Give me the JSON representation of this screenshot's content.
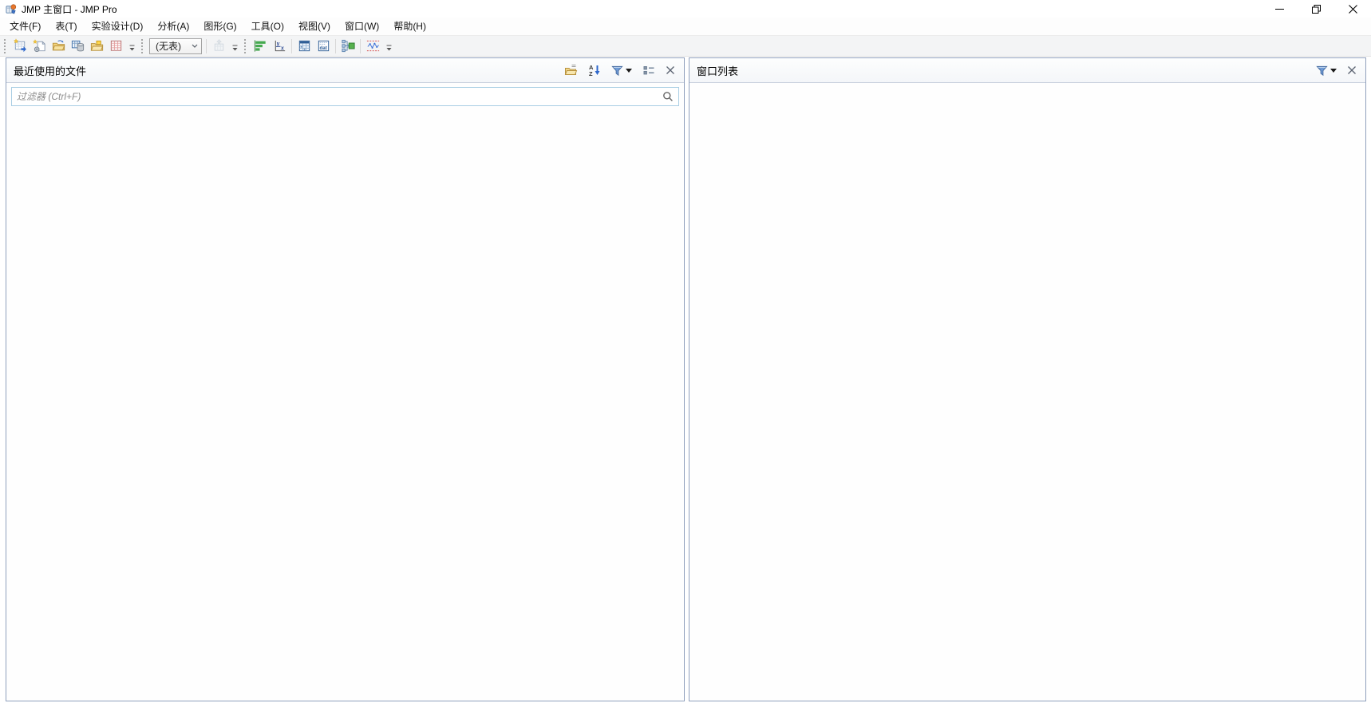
{
  "window": {
    "title": "JMP 主窗口 - JMP Pro",
    "controls": [
      "minimize",
      "restore",
      "close"
    ]
  },
  "menu_bar": {
    "items": [
      "文件(F)",
      "表(T)",
      "实验设计(D)",
      "分析(A)",
      "图形(G)",
      "工具(O)",
      "视图(V)",
      "窗口(W)",
      "帮助(H)"
    ]
  },
  "toolbar": {
    "file_group_icons": [
      "new-data-table-icon",
      "new-journal-icon",
      "open-file-icon",
      "database-open-table-icon",
      "open-script-icon",
      "data-grid-icon"
    ],
    "table_combo_value": "(无表)",
    "table_combo_disabled_icon": "bring-table-forward-icon",
    "analyze_group_icons": [
      "distribution-bars-icon",
      "fit-y-by-x-icon",
      "tabulate-icon",
      "data-view-icon",
      "merge-tables-icon",
      "control-chart-icon"
    ]
  },
  "recent_files_panel": {
    "title": "最近使用的文件",
    "filter_placeholder": "过滤器 (Ctrl+F)",
    "filter_value": "",
    "header_icons": [
      "open-folder-icon",
      "sort-az-icon",
      "filter-funnel-icon",
      "list-view-icon",
      "close-icon"
    ]
  },
  "window_list_panel": {
    "title": "窗口列表",
    "header_icons": [
      "filter-funnel-icon",
      "close-icon"
    ]
  },
  "colors": {
    "panel_border": "#90a0bc",
    "panel_header_separator": "#c9d1de",
    "filter_input_border": "#a9cee4",
    "funnel_blue": "#6f9bd6",
    "toolbar_green": "#44a94e",
    "control_limit_red": "#d23b3b",
    "chart_line_blue": "#3a6fd8",
    "folder_tan": "#f0d68c"
  }
}
